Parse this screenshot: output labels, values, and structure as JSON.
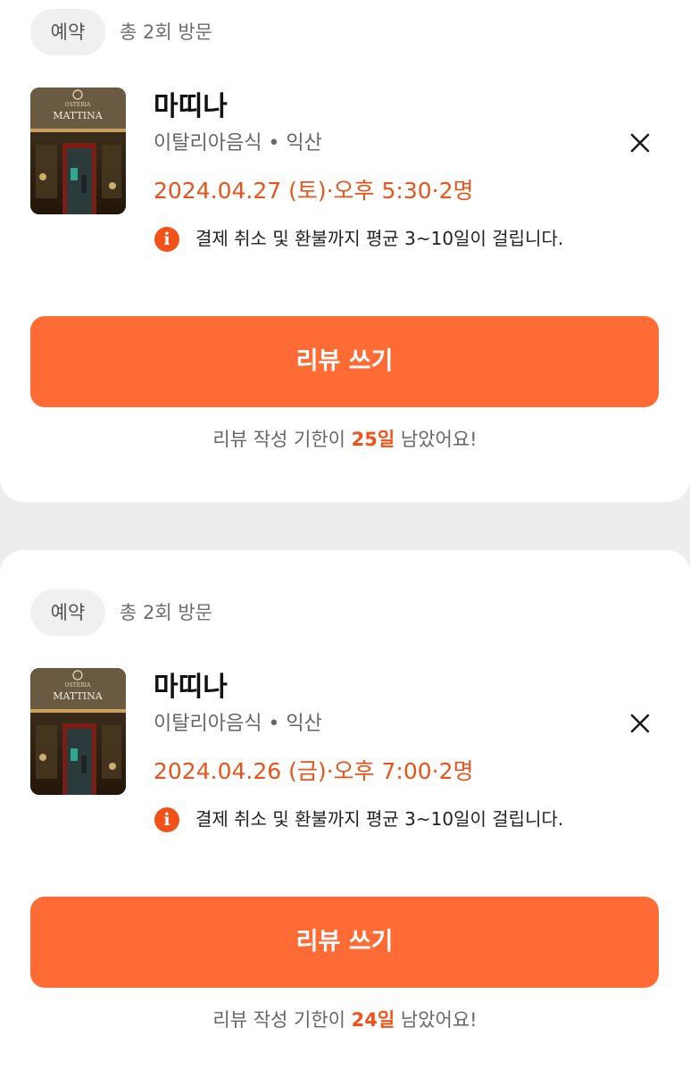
{
  "reservations": [
    {
      "badge": "예약",
      "visits": "총 2회 방문",
      "restaurant_name": "마띠나",
      "category": "이탈리아음식 • 익산",
      "datetime": "2024.04.27 (토)·오후 5:30·2명",
      "notice": "결제 취소 및 환불까지 평균 3~10일이 걸립니다.",
      "review_button": "리뷰 쓰기",
      "deadline_prefix": "리뷰 작성 기한이",
      "deadline_days": "25일",
      "deadline_suffix": "남았어요!",
      "thumbnail_sign": "MATTINA",
      "thumbnail_small": "OSTERIA",
      "close_icon": "close-icon",
      "info_icon": "info-icon",
      "info_glyph": "i"
    },
    {
      "badge": "예약",
      "visits": "총 2회 방문",
      "restaurant_name": "마띠나",
      "category": "이탈리아음식 • 익산",
      "datetime": "2024.04.26 (금)·오후 7:00·2명",
      "notice": "결제 취소 및 환불까지 평균 3~10일이 걸립니다.",
      "review_button": "리뷰 쓰기",
      "deadline_prefix": "리뷰 작성 기한이",
      "deadline_days": "24일",
      "deadline_suffix": "남았어요!",
      "thumbnail_sign": "MATTINA",
      "thumbnail_small": "OSTERIA",
      "close_icon": "close-icon",
      "info_icon": "info-icon",
      "info_glyph": "i"
    }
  ],
  "colors": {
    "accent": "#ff6b35",
    "accent_text": "#e8541c",
    "badge_bg": "#f0f0f0",
    "page_bg": "#ededed"
  }
}
